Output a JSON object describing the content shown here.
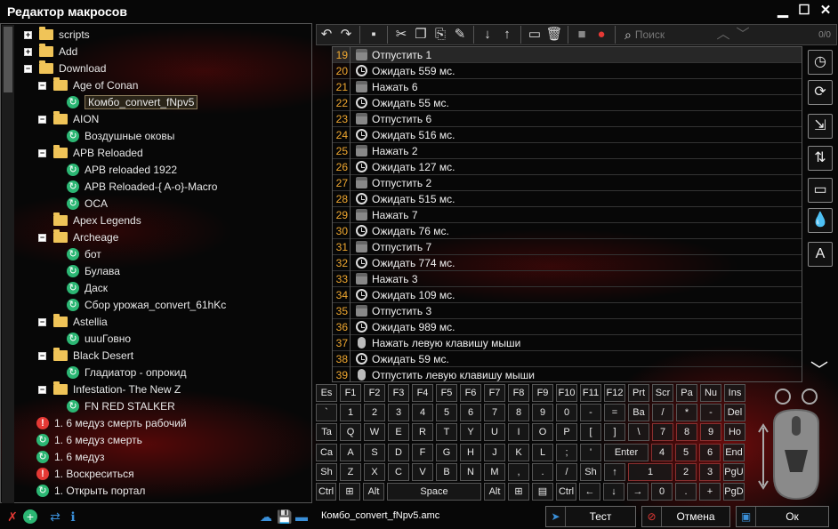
{
  "title": "Редактор макросов",
  "tree": [
    {
      "label": "scripts",
      "kind": "folder",
      "exp": "+",
      "indent": 0
    },
    {
      "label": "Add",
      "kind": "folder",
      "exp": "+",
      "indent": 0
    },
    {
      "label": "Download",
      "kind": "folder",
      "exp": "−",
      "indent": 0
    },
    {
      "label": "Age of Conan",
      "kind": "folder",
      "exp": "−",
      "indent": 1
    },
    {
      "label": "Комбо_convert_fNpv5",
      "kind": "macro",
      "indent": 2,
      "selected": true
    },
    {
      "label": "AION",
      "kind": "folder",
      "exp": "−",
      "indent": 1
    },
    {
      "label": "Воздушные оковы",
      "kind": "macro",
      "indent": 2
    },
    {
      "label": "APB Reloaded",
      "kind": "folder",
      "exp": "−",
      "indent": 1
    },
    {
      "label": "APB reloaded 1922",
      "kind": "macro",
      "indent": 2
    },
    {
      "label": "APB Reloaded-{ A-o}-Macro",
      "kind": "macro",
      "indent": 2
    },
    {
      "label": "OCA",
      "kind": "macro",
      "indent": 2
    },
    {
      "label": "Apex Legends",
      "kind": "folder",
      "indent": 1
    },
    {
      "label": "Archeage",
      "kind": "folder",
      "exp": "−",
      "indent": 1
    },
    {
      "label": "бот",
      "kind": "macro",
      "indent": 2
    },
    {
      "label": "Булава",
      "kind": "macro",
      "indent": 2
    },
    {
      "label": "Даск",
      "kind": "macro",
      "indent": 2
    },
    {
      "label": "Сбор урожая_convert_61hKc",
      "kind": "macro",
      "indent": 2
    },
    {
      "label": "Astellia",
      "kind": "folder",
      "exp": "−",
      "indent": 1
    },
    {
      "label": "uuuГовно",
      "kind": "macro",
      "indent": 2
    },
    {
      "label": "Black Desert",
      "kind": "folder",
      "exp": "−",
      "indent": 1
    },
    {
      "label": "Гладиатор - опрокид",
      "kind": "macro",
      "indent": 2
    },
    {
      "label": "Infestation- The New Z",
      "kind": "folder",
      "exp": "−",
      "indent": 1
    },
    {
      "label": "FN RED STALKER",
      "kind": "macro",
      "indent": 2
    },
    {
      "label": "1. 6 медуз смерть рабочий",
      "kind": "warn",
      "indent": 0
    },
    {
      "label": "1. 6 медуз смерть",
      "kind": "macro",
      "indent": 0
    },
    {
      "label": "1. 6 медуз",
      "kind": "macro",
      "indent": 0
    },
    {
      "label": "1. Воскреситься",
      "kind": "warn",
      "indent": 0
    },
    {
      "label": "1. Открыть портал",
      "kind": "macro",
      "indent": 0
    }
  ],
  "search": {
    "placeholder": "Поиск"
  },
  "counter": "0/0",
  "steps": [
    {
      "n": "19",
      "icon": "key",
      "text": "Отпустить 1"
    },
    {
      "n": "20",
      "icon": "clock",
      "text": "Ожидать 559 мс."
    },
    {
      "n": "21",
      "icon": "key",
      "text": "Нажать 6"
    },
    {
      "n": "22",
      "icon": "clock",
      "text": "Ожидать 55 мс."
    },
    {
      "n": "23",
      "icon": "key",
      "text": "Отпустить 6"
    },
    {
      "n": "24",
      "icon": "clock",
      "text": "Ожидать 516 мс."
    },
    {
      "n": "25",
      "icon": "key",
      "text": "Нажать 2"
    },
    {
      "n": "26",
      "icon": "clock",
      "text": "Ожидать 127 мс."
    },
    {
      "n": "27",
      "icon": "key",
      "text": "Отпустить 2"
    },
    {
      "n": "28",
      "icon": "clock",
      "text": "Ожидать 515 мс."
    },
    {
      "n": "29",
      "icon": "key",
      "text": "Нажать 7"
    },
    {
      "n": "30",
      "icon": "clock",
      "text": "Ожидать 76 мс."
    },
    {
      "n": "31",
      "icon": "key",
      "text": "Отпустить 7"
    },
    {
      "n": "32",
      "icon": "clock",
      "text": "Ожидать 774 мс."
    },
    {
      "n": "33",
      "icon": "key",
      "text": "Нажать 3"
    },
    {
      "n": "34",
      "icon": "clock",
      "text": "Ожидать 109 мс."
    },
    {
      "n": "35",
      "icon": "key",
      "text": "Отпустить 3"
    },
    {
      "n": "36",
      "icon": "clock",
      "text": "Ожидать 989 мс."
    },
    {
      "n": "37",
      "icon": "mouse",
      "text": "Нажать левую клавишу мыши"
    },
    {
      "n": "38",
      "icon": "clock",
      "text": "Ожидать 59 мс."
    },
    {
      "n": "39",
      "icon": "mouse",
      "text": "Отпустить левую клавишу мыши"
    }
  ],
  "keyboard": [
    [
      "Es",
      "F1",
      "F2",
      "F3",
      "F4",
      "F5",
      "F6",
      "F7",
      "F8",
      "F9",
      "F10",
      "F11",
      "F12",
      "Prt",
      "Scr",
      "Pa",
      "Nu",
      "Ins"
    ],
    [
      "`",
      "1",
      "2",
      "3",
      "4",
      "5",
      "6",
      "7",
      "8",
      "9",
      "0",
      "-",
      "=",
      "Ba",
      "/",
      "*",
      "-",
      "Del"
    ],
    [
      "Ta",
      "Q",
      "W",
      "E",
      "R",
      "T",
      "Y",
      "U",
      "I",
      "O",
      "P",
      "[",
      "]",
      "\\",
      "7",
      "8",
      "9",
      "Ho"
    ],
    [
      "Ca",
      "A",
      "S",
      "D",
      "F",
      "G",
      "H",
      "J",
      "K",
      "L",
      ";",
      "'",
      "Enter",
      "4",
      "5",
      "6",
      "End"
    ],
    [
      "Sh",
      "Z",
      "X",
      "C",
      "V",
      "B",
      "N",
      "M",
      ",",
      ".",
      "/",
      "Sh",
      "↑",
      "1",
      "2",
      "3",
      "PgU"
    ],
    [
      "Ctrl",
      "⊞",
      "Alt",
      "Space",
      "Alt",
      "⊞",
      "▤",
      "Ctrl",
      "←",
      "↓",
      "→",
      "0",
      ".",
      "+",
      "PgD"
    ]
  ],
  "bottom": {
    "filename": "Комбо_convert_fNpv5.amc",
    "test": "Тест",
    "cancel": "Отмена",
    "ok": "Ок"
  }
}
